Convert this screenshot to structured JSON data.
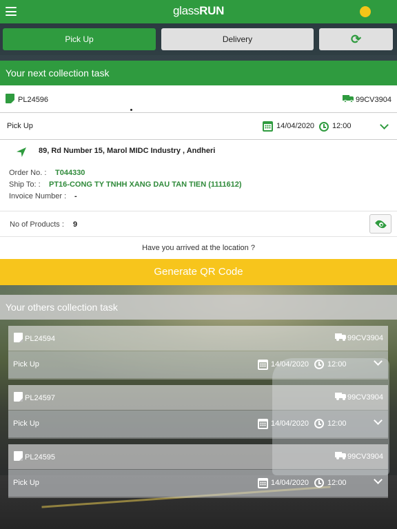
{
  "app": {
    "title_light": "glass",
    "title_bold": "RUN"
  },
  "tabs": [
    {
      "label": "Pick Up",
      "active": true
    },
    {
      "label": "Delivery",
      "active": false
    }
  ],
  "refresh_icon": "refresh-icon",
  "colors": {
    "primary": "#2f9b3f",
    "accent": "#f7c51c"
  },
  "next_task": {
    "header": "Your next collection task",
    "pl_number": "PL24596",
    "vehicle": "99CV3904",
    "type": "Pick Up",
    "date": "14/04/2020",
    "time": "12:00",
    "address": "89, Rd Number 15, Marol MIDC Industry , Andheri",
    "order_label": "Order No. :",
    "order_value": "T044330",
    "ship_label": "Ship To: :",
    "ship_value": "PT16-CONG TY TNHH XANG DAU TAN TIEN (1111612)",
    "invoice_label": "Invoice Number :",
    "invoice_value": "-",
    "products_label": "No of Products :",
    "products_value": "9",
    "arrived_prompt": "Have you arrived at the location ?",
    "qr_button": "Generate QR Code"
  },
  "others": {
    "header": "Your others collection task",
    "tasks": [
      {
        "pl_number": "PL24594",
        "vehicle": "99CV3904",
        "type": "Pick Up",
        "date": "14/04/2020",
        "time": "12:00"
      },
      {
        "pl_number": "PL24597",
        "vehicle": "99CV3904",
        "type": "Pick Up",
        "date": "14/04/2020",
        "time": "12:00"
      },
      {
        "pl_number": "PL24595",
        "vehicle": "99CV3904",
        "type": "Pick Up",
        "date": "14/04/2020",
        "time": "12:00"
      }
    ]
  }
}
